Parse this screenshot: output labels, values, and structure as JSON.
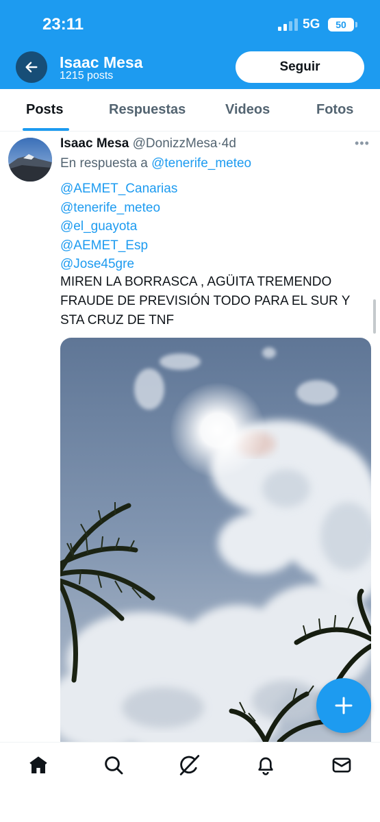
{
  "status_bar": {
    "time": "23:11",
    "network": "5G",
    "battery": "50"
  },
  "header": {
    "name": "Isaac Mesa",
    "post_count": "1215 posts",
    "follow_label": "Seguir"
  },
  "tabs": [
    {
      "label": "Posts",
      "active": true
    },
    {
      "label": "Respuestas",
      "active": false
    },
    {
      "label": "Videos",
      "active": false
    },
    {
      "label": "Fotos",
      "active": false
    }
  ],
  "post": {
    "author_name": "Isaac Mesa",
    "author_handle": "@DonizzMesa",
    "age": "4d",
    "reply_prefix": "En respuesta a",
    "reply_to": "@tenerife_meteo",
    "mentions": [
      "@AEMET_Canarias",
      "@tenerife_meteo",
      "@el_guayota",
      "@AEMET_Esp",
      "@Jose45gre"
    ],
    "text": "MIREN LA BORRASCA , AGÜITA TREMENDO FRAUDE DE PREVISIÓN TODO PARA EL SUR Y STA CRUZ DE TNF"
  },
  "icons": {
    "back": "arrow-left-icon",
    "more": "more-horizontal-icon",
    "fab": "plus-icon",
    "nav": [
      "home-icon",
      "search-icon",
      "grok-icon",
      "bell-icon",
      "mail-icon"
    ]
  },
  "colors": {
    "brand": "#1d9bf0",
    "text": "#0f1419",
    "secondary": "#536471"
  }
}
